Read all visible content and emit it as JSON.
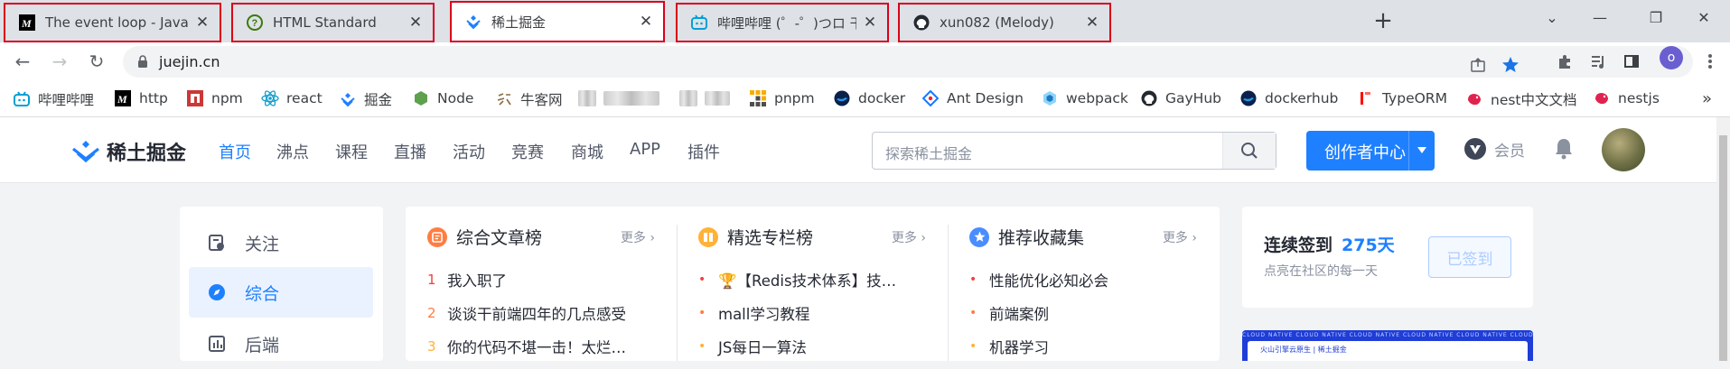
{
  "browser": {
    "tabs": [
      {
        "title": "The event loop - JavaScript | MDN",
        "favicon": "mdn-icon",
        "active": false
      },
      {
        "title": "HTML Standard",
        "favicon": "whatwg-icon",
        "active": false
      },
      {
        "title": "稀土掘金",
        "favicon": "juejin-icon",
        "active": true
      },
      {
        "title": "哔哩哔哩 (゜-゜)つロ 干杯~-bilibili",
        "favicon": "bilibili-icon",
        "active": false
      },
      {
        "title": "xun082 (Melody)",
        "favicon": "github-icon",
        "active": false
      }
    ],
    "new_tab": "+",
    "url": "juejin.cn",
    "profile_initial": "o"
  },
  "bookmarks": [
    {
      "label": "哔哩哔哩",
      "icon": "bilibili-icon"
    },
    {
      "label": "http",
      "icon": "mdn-icon"
    },
    {
      "label": "npm",
      "icon": "npm-icon"
    },
    {
      "label": "react",
      "icon": "react-icon"
    },
    {
      "label": "掘金",
      "icon": "juejin-icon"
    },
    {
      "label": "Node",
      "icon": "node-icon"
    },
    {
      "label": "牛客网",
      "icon": "nowcoder-icon"
    },
    {
      "label": "",
      "icon": "blurred-icon"
    },
    {
      "label": "",
      "icon": "blurred-icon"
    },
    {
      "label": "pnpm",
      "icon": "pnpm-icon"
    },
    {
      "label": "docker",
      "icon": "docker-icon"
    },
    {
      "label": "Ant Design",
      "icon": "antd-icon"
    },
    {
      "label": "webpack",
      "icon": "webpack-icon"
    },
    {
      "label": "GayHub",
      "icon": "github-icon"
    },
    {
      "label": "dockerhub",
      "icon": "docker-icon"
    },
    {
      "label": "TypeORM",
      "icon": "typeorm-icon"
    },
    {
      "label": "nest中文文档",
      "icon": "nest-icon"
    },
    {
      "label": "nestjs",
      "icon": "nest-icon"
    }
  ],
  "bookmarks_overflow": "»",
  "header": {
    "logo_text": "稀土掘金",
    "nav": [
      "首页",
      "沸点",
      "课程",
      "直播",
      "活动",
      "竞赛",
      "商城",
      "APP",
      "插件"
    ],
    "search_placeholder": "探索稀土掘金",
    "creator_button": "创作者中心",
    "vip_label": "会员"
  },
  "sidebar": {
    "items": [
      {
        "label": "关注",
        "icon": "follow-icon",
        "active": false
      },
      {
        "label": "综合",
        "icon": "compass-icon",
        "active": true
      },
      {
        "label": "后端",
        "icon": "backend-icon",
        "active": false
      }
    ]
  },
  "rankings": [
    {
      "title": "综合文章榜",
      "more": "更多",
      "icon_color": "#ff7d42",
      "items": [
        {
          "num": "1",
          "text": "我入职了"
        },
        {
          "num": "2",
          "text": "谈谈干前端四年的几点感受"
        },
        {
          "num": "3",
          "text": "你的代码不堪一击！太烂…"
        }
      ]
    },
    {
      "title": "精选专栏榜",
      "more": "更多",
      "icon_color": "#ffb238",
      "items": [
        {
          "num": "",
          "text": "🏆【Redis技术体系】技…"
        },
        {
          "num": "",
          "text": "mall学习教程"
        },
        {
          "num": "",
          "text": "JS每日一算法"
        }
      ]
    },
    {
      "title": "推荐收藏集",
      "more": "更多",
      "icon_color": "#4a8dff",
      "items": [
        {
          "num": "",
          "text": "性能优化必知必会"
        },
        {
          "num": "",
          "text": "前端案例"
        },
        {
          "num": "",
          "text": "机器学习"
        }
      ]
    }
  ],
  "signin": {
    "label": "连续签到",
    "days": "275天",
    "subtitle": "点亮在社区的每一天",
    "button": "已签到"
  },
  "banner": {
    "strip_text": "CLOUD NATIVE  CLOUD NATIVE  CLOUD NATIVE  CLOUD NATIVE  CLOUD NATIVE  CLOUD NATIVE  CLOUD NATIVE",
    "inner_text": "火山引擎云原生 | 稀土掘金"
  },
  "colors": {
    "brand": "#1e80ff",
    "tab_highlight": "#d9001b"
  }
}
